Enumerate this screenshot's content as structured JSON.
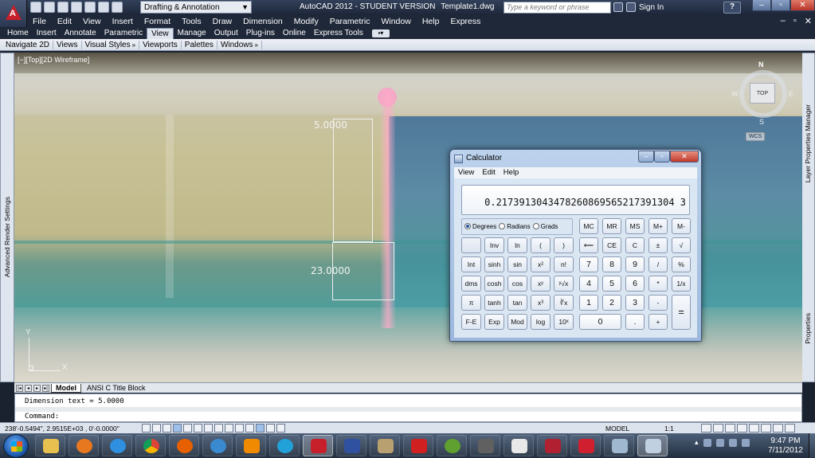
{
  "titlebar": {
    "workspace": "Drafting & Annotation",
    "title": "AutoCAD 2012 - STUDENT VERSION",
    "document": "Template1.dwg",
    "search_placeholder": "Type a keyword or phrase",
    "sign_in": "Sign In"
  },
  "menubar": [
    "File",
    "Edit",
    "View",
    "Insert",
    "Format",
    "Tools",
    "Draw",
    "Dimension",
    "Modify",
    "Parametric",
    "Window",
    "Help",
    "Express"
  ],
  "ribbon_tabs": [
    "Home",
    "Insert",
    "Annotate",
    "Parametric",
    "View",
    "Manage",
    "Output",
    "Plug-ins",
    "Online",
    "Express Tools"
  ],
  "ribbon_active_tab": "View",
  "ribbon_panels": [
    "Navigate 2D",
    "Views",
    "Visual Styles",
    "Viewports",
    "Palettes",
    "Windows"
  ],
  "viewport": {
    "label": "[−][Top][2D Wireframe]",
    "dim_top": "5.0000",
    "dim_bottom": "23.0000",
    "ucs_x": "X",
    "ucs_y": "Y",
    "viewcube": {
      "face": "TOP",
      "north": "N",
      "south": "S",
      "west": "W",
      "east": "E",
      "wcs": "WCS"
    }
  },
  "side_palettes": {
    "left": "Advanced Render Settings",
    "right_top": "Layer Properties Manager",
    "right_bottom": "Properties"
  },
  "layout_tabs": [
    "Model",
    "ANSI C Title Block"
  ],
  "command": {
    "history": "Dimension text = 5.0000",
    "prompt": "Command:"
  },
  "statusbar": {
    "coords": "238'-0.5494\", 2.9515E+03 , 0'-0.0000\"",
    "model": "MODEL",
    "scale": "1:1"
  },
  "calculator": {
    "title": "Calculator",
    "menu": [
      "View",
      "Edit",
      "Help"
    ],
    "display": "0.2173913043478260869565217391304 3",
    "angles": [
      {
        "label": "Degrees",
        "selected": true
      },
      {
        "label": "Radians",
        "selected": false
      },
      {
        "label": "Grads",
        "selected": false
      }
    ],
    "keys": {
      "mc": "MC",
      "mr": "MR",
      "ms": "MS",
      "mplus": "M+",
      "mminus": "M-",
      "inv": "Inv",
      "ln": "ln",
      "lparen": "(",
      "rparen": ")",
      "back": "⟵",
      "ce": "CE",
      "c": "C",
      "pm": "±",
      "sqrt": "√",
      "int": "Int",
      "sinh": "sinh",
      "sin": "sin",
      "x2": "x²",
      "fact": "n!",
      "seven": "7",
      "eight": "8",
      "nine": "9",
      "div": "/",
      "pct": "%",
      "dms": "dms",
      "cosh": "cosh",
      "cos": "cos",
      "xy": "xʸ",
      "yroot": "ʸ√x",
      "four": "4",
      "five": "5",
      "six": "6",
      "mul": "*",
      "recip": "1/x",
      "pi": "π",
      "tanh": "tanh",
      "tan": "tan",
      "x3": "x³",
      "cbrt": "∛x",
      "one": "1",
      "two": "2",
      "three": "3",
      "sub": "-",
      "eq": "=",
      "fe": "F-E",
      "exp": "Exp",
      "mod": "Mod",
      "log": "log",
      "tenx": "10ˣ",
      "zero": "0",
      "dot": ".",
      "add": "+"
    }
  },
  "taskbar": {
    "time": "9:47 PM",
    "date": "7/11/2012"
  }
}
